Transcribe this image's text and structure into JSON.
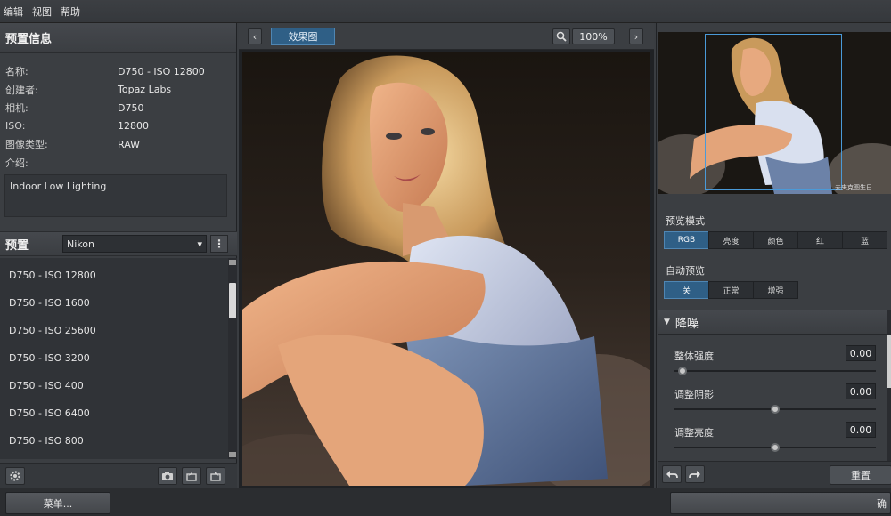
{
  "menu": {
    "items": [
      "编辑",
      "视图",
      "帮助"
    ]
  },
  "preset_info": {
    "title": "预置信息",
    "rows": [
      {
        "key": "名称:",
        "value": "D750 - ISO 12800"
      },
      {
        "key": "创建者:",
        "value": "Topaz Labs"
      },
      {
        "key": "相机:",
        "value": "D750"
      },
      {
        "key": "ISO:",
        "value": "12800"
      },
      {
        "key": "图像类型:",
        "value": "RAW"
      }
    ],
    "desc_label": "介绍:",
    "description": "Indoor Low Lighting"
  },
  "presets": {
    "title": "预置",
    "selected_brand": "Nikon",
    "more_icon": "vertical-dots-icon",
    "items": [
      "D750 - ISO 12800",
      "D750 - ISO 1600",
      "D750 - ISO 25600",
      "D750 - ISO 3200",
      "D750 - ISO 400",
      "D750 - ISO 6400",
      "D750 - ISO 800"
    ]
  },
  "left_toolbar": {
    "icons": [
      "gear-icon",
      "camera-icon",
      "import-icon",
      "export-icon"
    ]
  },
  "viewer": {
    "prev_label": "‹",
    "next_label": "›",
    "mode_label": "效果图",
    "zoom": "100%"
  },
  "navigator": {
    "caption": "去夹克图生日"
  },
  "preview_mode": {
    "label": "预览模式",
    "options": [
      "RGB",
      "亮度",
      "颜色",
      "红",
      "蓝"
    ],
    "active": "RGB"
  },
  "auto_preview": {
    "label": "自动预览",
    "options": [
      "关",
      "正常",
      "增强"
    ],
    "active": "关"
  },
  "noise": {
    "title": "降噪",
    "sliders": [
      {
        "label": "整体强度",
        "value": "0.00",
        "level": 0.0
      },
      {
        "label": "调整阴影",
        "value": "0.00",
        "level": 0.5
      },
      {
        "label": "调整亮度",
        "value": "0.00",
        "level": 0.5
      }
    ]
  },
  "right_toolbar": {
    "undo_icon": "undo-icon",
    "redo_icon": "redo-icon",
    "reset_label": "重置"
  },
  "status": {
    "menu_label": "菜单...",
    "apply_label": "确"
  },
  "colors": {
    "accent": "#2f5f86",
    "panel": "#3b3e42",
    "background": "#202225"
  }
}
